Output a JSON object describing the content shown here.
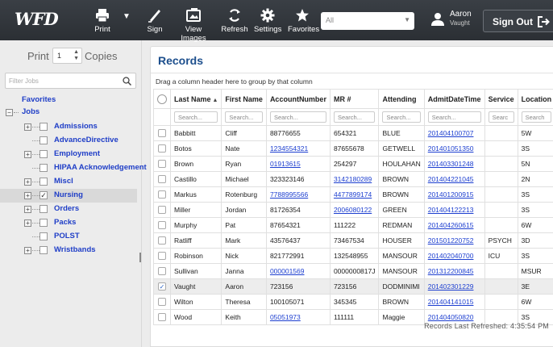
{
  "toolbar": {
    "logo": "WFD",
    "print_label": "Print",
    "sign_label": "Sign",
    "view_images_label": "View Images",
    "refresh_label": "Refresh",
    "settings_label": "Settings",
    "favorites_label": "Favorites",
    "filter_select_value": "All",
    "user_name": "Aaron",
    "user_sub": "Vaught",
    "signout_label": "Sign Out"
  },
  "sidebar": {
    "print_label": "Print",
    "copies_value": "1",
    "copies_label": "Copies",
    "filter_placeholder": "Filter Jobs",
    "favorites_label": "Favorites",
    "jobs_label": "Jobs",
    "items": [
      {
        "label": "Admissions",
        "expandable": true,
        "checked": false
      },
      {
        "label": "AdvanceDirective",
        "expandable": false,
        "checked": false
      },
      {
        "label": "Employment",
        "expandable": true,
        "checked": false
      },
      {
        "label": "HIPAA Acknowledgement",
        "expandable": false,
        "checked": false
      },
      {
        "label": "Miscl",
        "expandable": true,
        "checked": false
      },
      {
        "label": "Nursing",
        "expandable": true,
        "checked": true
      },
      {
        "label": "Orders",
        "expandable": true,
        "checked": false
      },
      {
        "label": "Packs",
        "expandable": true,
        "checked": false
      },
      {
        "label": "POLST",
        "expandable": false,
        "checked": false
      },
      {
        "label": "Wristbands",
        "expandable": true,
        "checked": false
      }
    ]
  },
  "main": {
    "title": "Records",
    "group_hint": "Drag a column header here to group by that column",
    "columns": [
      "Last Name",
      "First Name",
      "AccountNumber",
      "MR #",
      "Attending",
      "AdmitDateTime",
      "Service",
      "Location",
      "E"
    ],
    "search_placeholders": [
      "Search...",
      "Search...",
      "Search...",
      "Search...",
      "Search...",
      "Search...",
      "Searc",
      "Search",
      ""
    ],
    "rows": [
      {
        "checked": false,
        "cells": [
          "Babbitt",
          "Cliff",
          "88776655",
          "654321",
          "BLUE",
          "201404100707",
          "",
          "5W"
        ]
      },
      {
        "checked": false,
        "cells": [
          "Botos",
          "Nate",
          "1234554321",
          "87655678",
          "GETWELL",
          "201401051350",
          "",
          "3S"
        ]
      },
      {
        "checked": false,
        "cells": [
          "Brown",
          "Ryan",
          "01913615",
          "254297",
          "HOULAHAN",
          "201403301248",
          "",
          "5N"
        ]
      },
      {
        "checked": false,
        "cells": [
          "Castillo",
          "Michael",
          "323323146",
          "3142180289",
          "BROWN",
          "201404221045",
          "",
          "2N"
        ]
      },
      {
        "checked": false,
        "cells": [
          "Markus",
          "Rotenburg",
          "7788995566",
          "4477899174",
          "BROWN",
          "201401200915",
          "",
          "3S"
        ]
      },
      {
        "checked": false,
        "cells": [
          "Miller",
          "Jordan",
          "81726354",
          "2006080122",
          "GREEN",
          "201404122213",
          "",
          "3S"
        ]
      },
      {
        "checked": false,
        "cells": [
          "Murphy",
          "Pat",
          "87654321",
          "111222",
          "REDMAN",
          "201404260615",
          "",
          "6W"
        ]
      },
      {
        "checked": false,
        "cells": [
          "Ratliff",
          "Mark",
          "43576437",
          "73467534",
          "HOUSER",
          "201501220752",
          "PSYCH",
          "3D"
        ]
      },
      {
        "checked": false,
        "cells": [
          "Robinson",
          "Nick",
          "821772991",
          "132548955",
          "MANSOUR",
          "201402040700",
          "ICU",
          "3S"
        ]
      },
      {
        "checked": false,
        "cells": [
          "Sullivan",
          "Janna",
          "000001569",
          "0000000817J",
          "MANSOUR",
          "201312200845",
          "",
          "MSUR"
        ]
      },
      {
        "checked": true,
        "cells": [
          "Vaught",
          "Aaron",
          "723156",
          "723156",
          "DODMINIMI",
          "201402301229",
          "",
          "3E"
        ]
      },
      {
        "checked": false,
        "cells": [
          "Wilton",
          "Theresa",
          "100105071",
          "345345",
          "BROWN",
          "201404141015",
          "",
          "6W"
        ]
      },
      {
        "checked": false,
        "cells": [
          "Wood",
          "Keith",
          "05051973",
          "111111",
          "Maggie",
          "201404050820",
          "",
          "3S"
        ]
      }
    ],
    "link_cells": [
      [
        0,
        5
      ],
      [
        1,
        2
      ],
      [
        1,
        5
      ],
      [
        2,
        2
      ],
      [
        2,
        5
      ],
      [
        3,
        3
      ],
      [
        3,
        5
      ],
      [
        4,
        2
      ],
      [
        4,
        3
      ],
      [
        4,
        5
      ],
      [
        5,
        3
      ],
      [
        5,
        5
      ],
      [
        6,
        5
      ],
      [
        7,
        5
      ],
      [
        8,
        5
      ],
      [
        9,
        2
      ],
      [
        9,
        5
      ],
      [
        10,
        5
      ],
      [
        11,
        5
      ],
      [
        12,
        2
      ],
      [
        12,
        5
      ]
    ],
    "refreshed_text": "Records Last Refreshed: 4:35:54 PM"
  }
}
